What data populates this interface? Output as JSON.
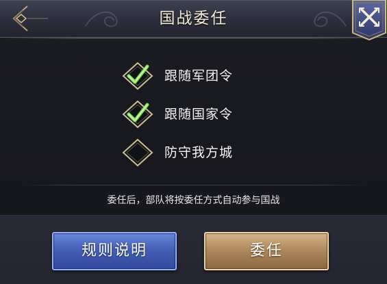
{
  "dialog": {
    "title": "国战委任",
    "hint": "委任后，部队将按委任方式自动参与国战"
  },
  "options": [
    {
      "label": "跟随军团令",
      "checked": true
    },
    {
      "label": "跟随国家令",
      "checked": true
    },
    {
      "label": "防守我方城",
      "checked": false
    }
  ],
  "buttons": {
    "rules_label": "规则说明",
    "entrust_label": "委任"
  },
  "icons": {
    "back": "back-arrow-icon",
    "close": "close-x-icon",
    "check": "checkmark-icon"
  },
  "colors": {
    "check_green": "#7fe05a",
    "rules_button": "#4560b6",
    "entrust_button": "#b08a5f"
  }
}
